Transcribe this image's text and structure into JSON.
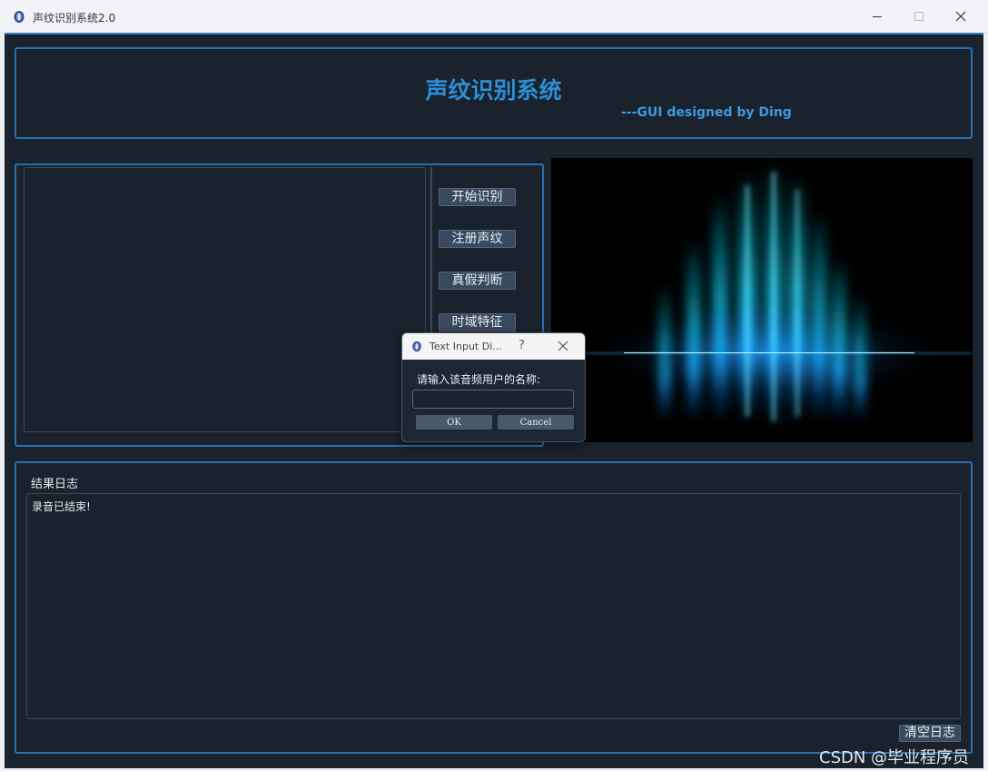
{
  "window": {
    "title": "声纹识别系统2.0"
  },
  "header": {
    "title": "声纹识别系统",
    "designer": "---GUI designed by Ding"
  },
  "side_buttons": {
    "start_recognition": "开始识别",
    "register_voiceprint": "注册声纹",
    "authenticity_check": "真假判断",
    "time_domain_features": "时域特征"
  },
  "log": {
    "label": "结果日志",
    "text": "录音已结束!",
    "clear_button": "清空日志"
  },
  "dialog": {
    "title": "Text Input Di...",
    "help": "?",
    "prompt": "请输入该音频用户的名称:",
    "input_value": "",
    "ok": "OK",
    "cancel": "Cancel"
  },
  "watermark": "CSDN @毕业程序员",
  "icons": {
    "app": "app-logo-icon",
    "minimize": "minimize-icon",
    "maximize": "maximize-icon",
    "close": "close-icon",
    "dialog_close": "close-icon"
  },
  "colors": {
    "background": "#19222d",
    "accent_border": "#2a6fb0",
    "title_blue": "#2d8fd6",
    "button_bg": "#3a4a5e"
  }
}
